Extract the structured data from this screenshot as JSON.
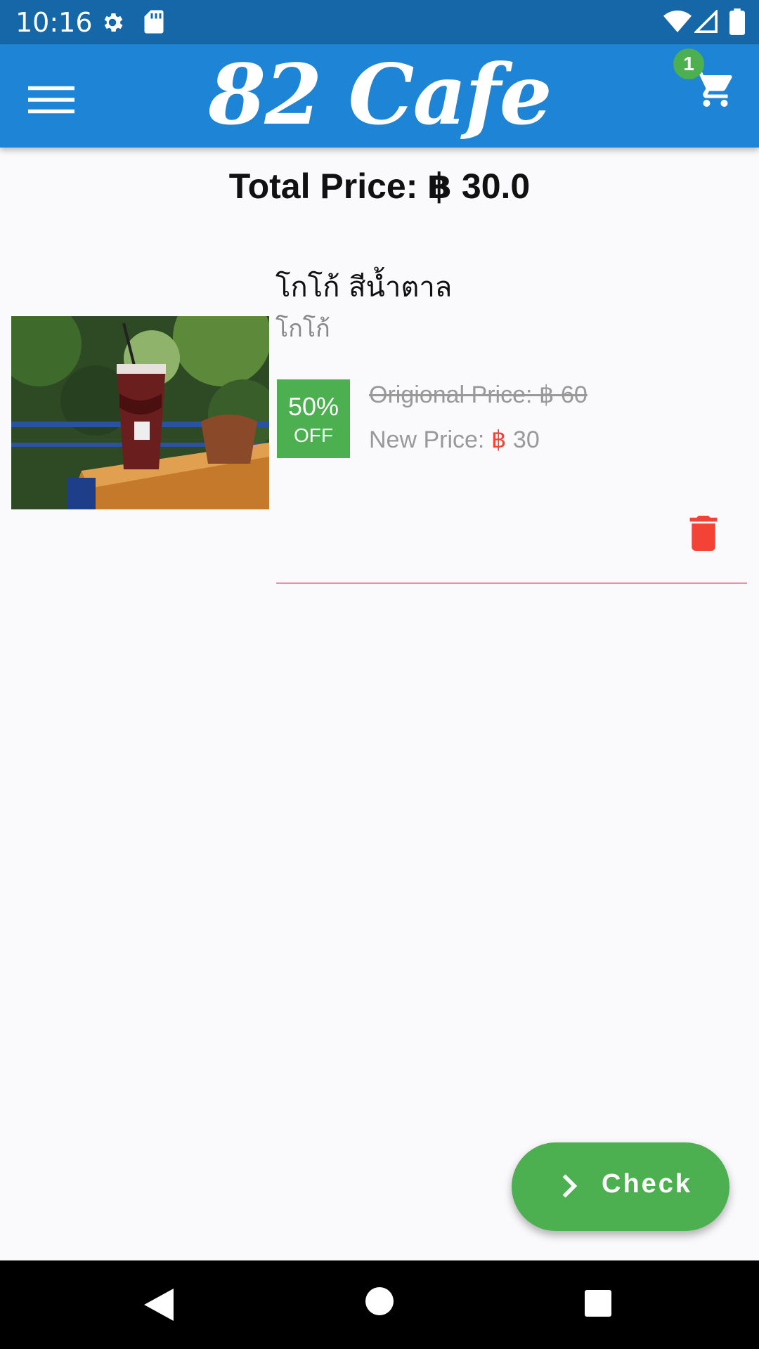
{
  "status_bar": {
    "time": "10:16",
    "icons": [
      "gear-icon",
      "sd-card-icon",
      "wifi-icon",
      "signal-icon",
      "battery-icon"
    ]
  },
  "app_bar": {
    "title": "82 Cafe",
    "cart_count": "1",
    "color": "#1d84d6"
  },
  "cart": {
    "total_price": "Total Price: ฿ 30.0",
    "items": [
      {
        "name": "โกโก้ สีน้ำตาล",
        "category": "โกโก้",
        "discount_percent": "50%",
        "discount_off": "OFF",
        "original_price": "Origional Price: ฿ 60",
        "new_price_label": "New Price:",
        "new_price_currency": "฿",
        "new_price_value": "30"
      }
    ]
  },
  "fab": {
    "label": "Check",
    "color": "#4caf50"
  },
  "colors": {
    "accent": "#1d84d6",
    "status_bar": "#1667a8",
    "success": "#4caf50",
    "danger": "#f44336"
  }
}
